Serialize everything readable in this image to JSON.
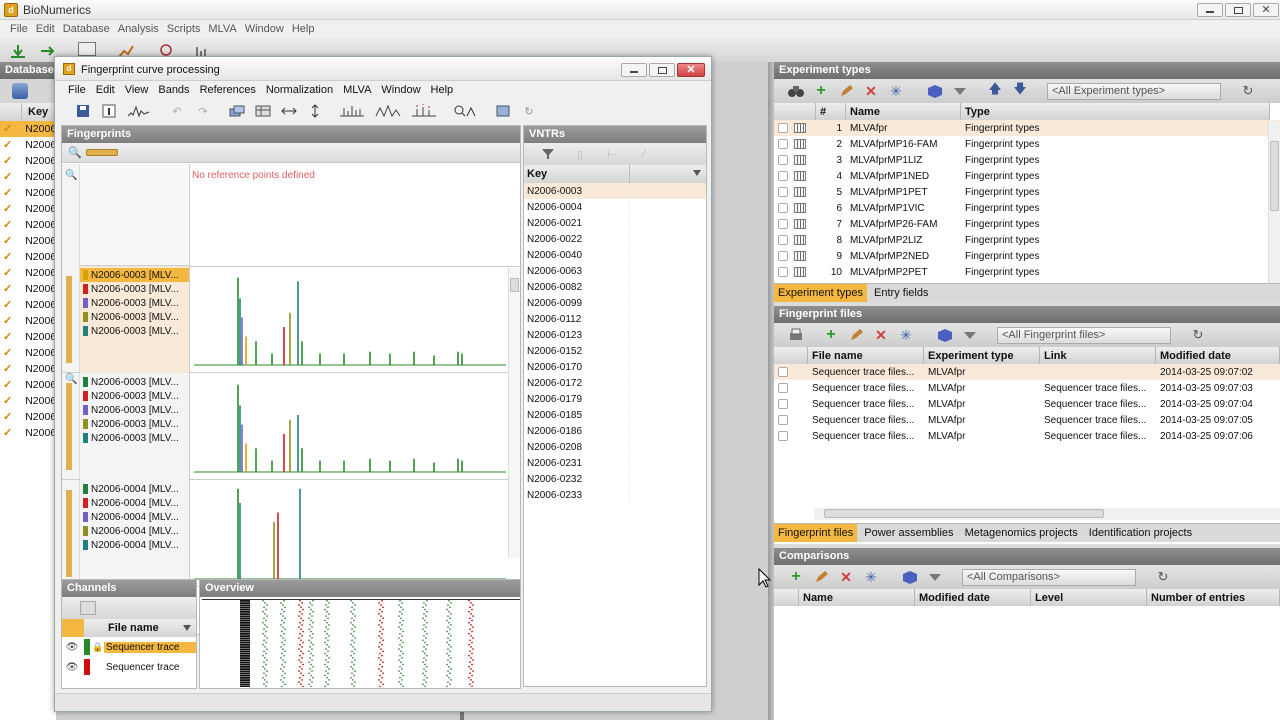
{
  "app": {
    "title": "BioNumerics",
    "menu": [
      "File",
      "Edit",
      "Database",
      "Analysis",
      "Scripts",
      "MLVA",
      "Window",
      "Help"
    ]
  },
  "left_panel": {
    "header": "Database",
    "key_header": "Key",
    "rows": [
      "N2006",
      "N2006",
      "N2006",
      "N2006",
      "N2006",
      "N2006",
      "N2006",
      "N2006",
      "N2006",
      "N2006",
      "N2006",
      "N2006",
      "N2006",
      "N2006",
      "N2006",
      "N2006",
      "N2006",
      "N2006",
      "N2006",
      "N2006"
    ]
  },
  "fp_window": {
    "title": "Fingerprint curve processing",
    "menu": [
      "File",
      "Edit",
      "View",
      "Bands",
      "References",
      "Normalization",
      "MLVA",
      "Window",
      "Help"
    ],
    "fingerprints_header": "Fingerprints",
    "no_ref_text": "No reference points defined",
    "groups": [
      {
        "items": [
          {
            "label": "N2006-0003 [MLV...",
            "color": "#d8a000",
            "selected": true
          },
          {
            "label": "N2006-0003 [MLV...",
            "color": "#d02020"
          },
          {
            "label": "N2006-0003 [MLV...",
            "color": "#7060c8"
          },
          {
            "label": "N2006-0003 [MLV...",
            "color": "#909020"
          },
          {
            "label": "N2006-0003 [MLV...",
            "color": "#208080"
          }
        ]
      },
      {
        "items": [
          {
            "label": "N2006-0003 [MLV...",
            "color": "#208040"
          },
          {
            "label": "N2006-0003 [MLV...",
            "color": "#d02020"
          },
          {
            "label": "N2006-0003 [MLV...",
            "color": "#7060c8"
          },
          {
            "label": "N2006-0003 [MLV...",
            "color": "#909020"
          },
          {
            "label": "N2006-0003 [MLV...",
            "color": "#208080"
          }
        ]
      },
      {
        "items": [
          {
            "label": "N2006-0004 [MLV...",
            "color": "#208040"
          },
          {
            "label": "N2006-0004 [MLV...",
            "color": "#d02020"
          },
          {
            "label": "N2006-0004 [MLV...",
            "color": "#7060c8"
          },
          {
            "label": "N2006-0004 [MLV...",
            "color": "#909020"
          },
          {
            "label": "N2006-0004 [MLV...",
            "color": "#208080"
          }
        ]
      }
    ],
    "vntrs_header": "VNTRs",
    "vntrs_key_header": "Key",
    "vntrs_keys": [
      "N2006-0003",
      "N2006-0004",
      "N2006-0021",
      "N2006-0022",
      "N2006-0040",
      "N2006-0063",
      "N2006-0082",
      "N2006-0099",
      "N2006-0112",
      "N2006-0123",
      "N2006-0152",
      "N2006-0170",
      "N2006-0172",
      "N2006-0179",
      "N2006-0185",
      "N2006-0186",
      "N2006-0208",
      "N2006-0231",
      "N2006-0232",
      "N2006-0233"
    ],
    "channels_header": "Channels",
    "channels_col": "File name",
    "channels": [
      {
        "label": "Sequencer trace",
        "color": "#2a8a2a",
        "selected": true
      },
      {
        "label": "Sequencer trace",
        "color": "#cc1010",
        "selected": false
      }
    ],
    "overview_header": "Overview"
  },
  "experiment_types": {
    "header": "Experiment types",
    "dropdown": "<All Experiment types>",
    "columns": [
      "#",
      "Name",
      "Type"
    ],
    "rows": [
      {
        "num": "1",
        "name": "MLVAfpr",
        "type": "Fingerprint types"
      },
      {
        "num": "2",
        "name": "MLVAfprMP16-FAM",
        "type": "Fingerprint types"
      },
      {
        "num": "3",
        "name": "MLVAfprMP1LIZ",
        "type": "Fingerprint types"
      },
      {
        "num": "4",
        "name": "MLVAfprMP1NED",
        "type": "Fingerprint types"
      },
      {
        "num": "5",
        "name": "MLVAfprMP1PET",
        "type": "Fingerprint types"
      },
      {
        "num": "6",
        "name": "MLVAfprMP1VIC",
        "type": "Fingerprint types"
      },
      {
        "num": "7",
        "name": "MLVAfprMP26-FAM",
        "type": "Fingerprint types"
      },
      {
        "num": "8",
        "name": "MLVAfprMP2LIZ",
        "type": "Fingerprint types"
      },
      {
        "num": "9",
        "name": "MLVAfprMP2NED",
        "type": "Fingerprint types"
      },
      {
        "num": "10",
        "name": "MLVAfprMP2PET",
        "type": "Fingerprint types"
      }
    ],
    "tabs": [
      "Experiment types",
      "Entry fields"
    ]
  },
  "fingerprint_files": {
    "header": "Fingerprint files",
    "dropdown": "<All Fingerprint files>",
    "columns": [
      "File name",
      "Experiment type",
      "Link",
      "Modified date"
    ],
    "rows": [
      {
        "file": "Sequencer trace files...",
        "exp": "MLVAfpr",
        "link": "",
        "date": "2014-03-25 09:07:02"
      },
      {
        "file": "Sequencer trace files...",
        "exp": "MLVAfpr",
        "link": "Sequencer trace files...",
        "date": "2014-03-25 09:07:03"
      },
      {
        "file": "Sequencer trace files...",
        "exp": "MLVAfpr",
        "link": "Sequencer trace files...",
        "date": "2014-03-25 09:07:04"
      },
      {
        "file": "Sequencer trace files...",
        "exp": "MLVAfpr",
        "link": "Sequencer trace files...",
        "date": "2014-03-25 09:07:05"
      },
      {
        "file": "Sequencer trace files...",
        "exp": "MLVAfpr",
        "link": "Sequencer trace files...",
        "date": "2014-03-25 09:07:06"
      }
    ],
    "tabs": [
      "Fingerprint files",
      "Power assemblies",
      "Metagenomics projects",
      "Identification projects"
    ]
  },
  "comparisons": {
    "header": "Comparisons",
    "dropdown": "<All Comparisons>",
    "columns": [
      "Name",
      "Modified date",
      "Level",
      "Number of entries"
    ]
  },
  "colors": {
    "accent": "#f4b740",
    "panel_header": "#7a7a7a",
    "selection": "#f8e9d8"
  }
}
